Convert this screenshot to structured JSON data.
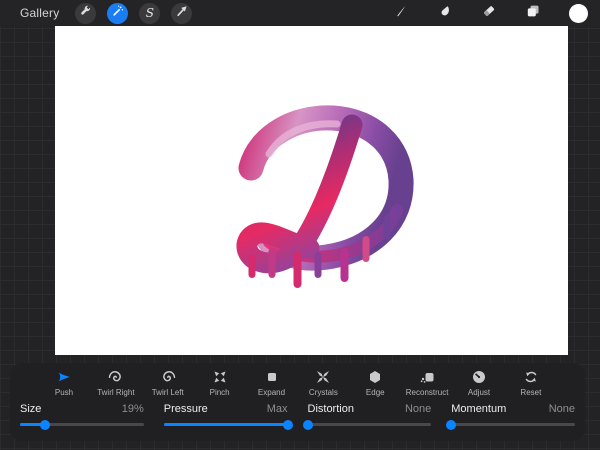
{
  "topbar": {
    "gallery_label": "Gallery"
  },
  "canvas": {
    "artwork_letter": "D"
  },
  "liquify": {
    "tools": [
      {
        "label": "Push",
        "selected": true
      },
      {
        "label": "Twirl Right",
        "selected": false
      },
      {
        "label": "Twirl Left",
        "selected": false
      },
      {
        "label": "Pinch",
        "selected": false
      },
      {
        "label": "Expand",
        "selected": false
      },
      {
        "label": "Crystals",
        "selected": false
      },
      {
        "label": "Edge",
        "selected": false
      },
      {
        "label": "Reconstruct",
        "selected": false
      },
      {
        "label": "Adjust",
        "selected": false
      },
      {
        "label": "Reset",
        "selected": false
      }
    ],
    "sliders": [
      {
        "label": "Size",
        "value": "19%",
        "percent": 20
      },
      {
        "label": "Pressure",
        "value": "Max",
        "percent": 100
      },
      {
        "label": "Distortion",
        "value": "None",
        "percent": 0
      },
      {
        "label": "Momentum",
        "value": "None",
        "percent": 0
      }
    ]
  },
  "colors": {
    "accent_blue": "#0a84ff",
    "selected_circle_blue": "#1a7ef2",
    "background": "#232325",
    "panel_bg": "#202022",
    "canvas_white": "#ffffff",
    "artwork_magenta": "#e02a63",
    "artwork_light_pink": "#d795c5",
    "artwork_purple": "#67408f"
  }
}
